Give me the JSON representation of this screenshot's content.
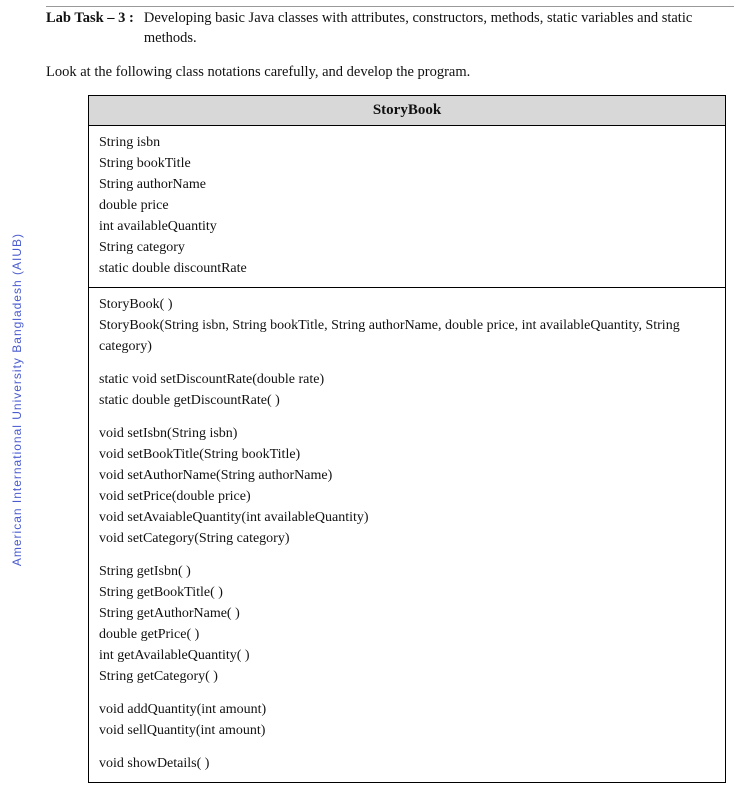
{
  "watermark": "American International University Bangladesh (AIUB)",
  "task": {
    "label": "Lab Task – 3 :",
    "description": "Developing basic Java classes with attributes, constructors, methods, static variables and static methods."
  },
  "instruction": "Look at the following class notations carefully, and develop the program.",
  "uml": {
    "className": "StoryBook",
    "attributes": [
      "String isbn",
      "String bookTitle",
      "String authorName",
      "double price",
      "int availableQuantity",
      "String category",
      "static double discountRate"
    ],
    "constructors": [
      "StoryBook( )",
      "StoryBook(String isbn, String bookTitle, String authorName, double price, int availableQuantity, String category)"
    ],
    "staticMethods": [
      "static void setDiscountRate(double rate)",
      "static double getDiscountRate( )"
    ],
    "setters": [
      "void setIsbn(String isbn)",
      "void setBookTitle(String bookTitle)",
      "void setAuthorName(String authorName)",
      "void setPrice(double price)",
      "void setAvaiableQuantity(int availableQuantity)",
      "void setCategory(String category)"
    ],
    "getters": [
      "String getIsbn( )",
      "String getBookTitle( )",
      "String getAuthorName( )",
      "double getPrice( )",
      "int getAvailableQuantity( )",
      "String getCategory( )"
    ],
    "quantityOps": [
      "void addQuantity(int amount)",
      "void sellQuantity(int amount)"
    ],
    "display": [
      "void showDetails( )"
    ]
  }
}
